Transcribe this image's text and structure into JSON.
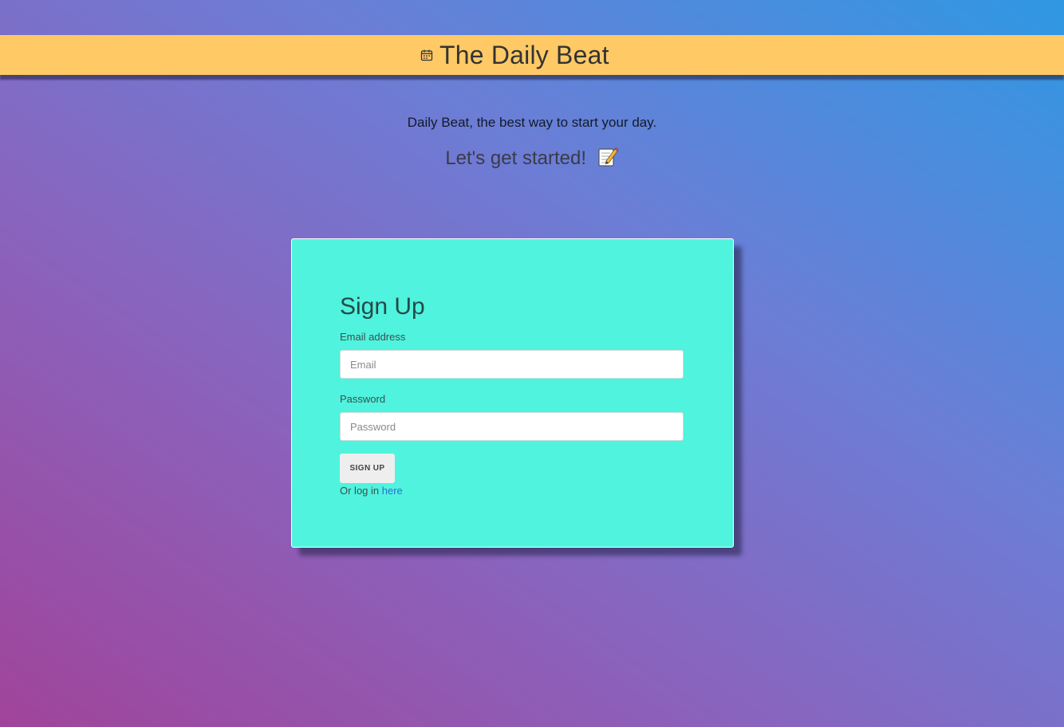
{
  "header": {
    "title": "The Daily Beat",
    "icon": "calendar-icon"
  },
  "hero": {
    "tagline": "Daily Beat, the best way to start your day.",
    "cta": "Let's get started!",
    "cta_icon": "memo-icon"
  },
  "form": {
    "title": "Sign Up",
    "email_label": "Email address",
    "email_placeholder": "Email",
    "email_value": "",
    "password_label": "Password",
    "password_placeholder": "Password",
    "password_value": "",
    "submit_label": "SIGN UP",
    "login_prefix": "Or log in",
    "login_link": "here"
  },
  "colors": {
    "header_bg": "#ffc966",
    "card_bg": "#50f3dd",
    "link": "#2a6fd1"
  }
}
